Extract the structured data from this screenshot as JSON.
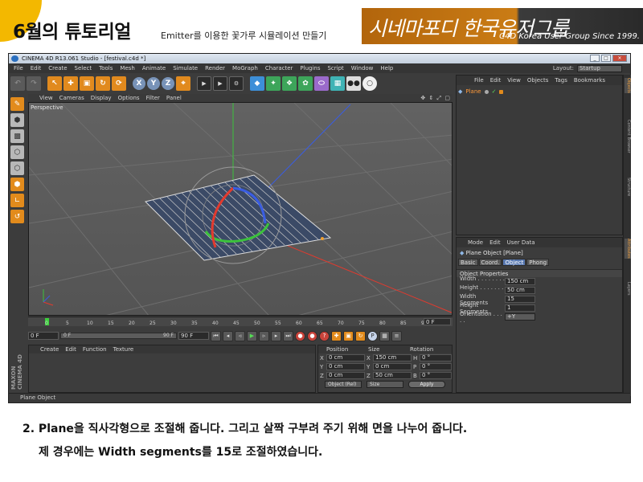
{
  "header": {
    "title": "6월의 튜토리얼",
    "subtitle": "Emitter를 이용한 꽃가루 시뮬레이션 만들기",
    "banner_script": "시네마포디 한국유저그룹",
    "banner_text": "C4D Korea User Group Since 1999."
  },
  "window": {
    "title": "CINEMA 4D R13.061 Studio - [festival.c4d *]",
    "buttons": [
      "_",
      "□",
      "×"
    ],
    "menus": [
      "File",
      "Edit",
      "Create",
      "Select",
      "Tools",
      "Mesh",
      "Animate",
      "Simulate",
      "Render",
      "MoGraph",
      "Character",
      "Plugins",
      "Script",
      "Window",
      "Help"
    ],
    "layout_label": "Layout:",
    "layout_value": "Startup"
  },
  "toolbar": {
    "axis_x": "X",
    "axis_y": "Y",
    "axis_z": "Z"
  },
  "viewport": {
    "menus": [
      "View",
      "Cameras",
      "Display",
      "Options",
      "Filter",
      "Panel"
    ],
    "label": "Perspective",
    "nav_icons": "✥ ⇕ ⤢ ▢"
  },
  "timeline": {
    "ticks": [
      "0",
      "5",
      "10",
      "15",
      "20",
      "25",
      "30",
      "35",
      "40",
      "45",
      "50",
      "55",
      "60",
      "65",
      "70",
      "75",
      "80",
      "85",
      "90"
    ],
    "current_frame": "0 F",
    "start_field": "0 F",
    "slider_start": "0 F",
    "slider_end": "90 F",
    "end_field": "90 F"
  },
  "material_manager": {
    "menus": [
      "Create",
      "Edit",
      "Function",
      "Texture"
    ],
    "brand": "MAXON CINEMA 4D"
  },
  "coordinates": {
    "headers": [
      "Position",
      "Size",
      "Rotation"
    ],
    "rows": [
      {
        "axis": "X",
        "pos": "0 cm",
        "size_axis": "X",
        "size": "150 cm",
        "rot_axis": "H",
        "rot": "0 °"
      },
      {
        "axis": "Y",
        "pos": "0 cm",
        "size_axis": "Y",
        "size": "0 cm",
        "rot_axis": "P",
        "rot": "0 °"
      },
      {
        "axis": "Z",
        "pos": "0 cm",
        "size_axis": "Z",
        "size": "50 cm",
        "rot_axis": "B",
        "rot": "0 °"
      }
    ],
    "mode_dropdown": "Object (Rel)",
    "size_dropdown": "Size",
    "apply": "Apply"
  },
  "object_manager": {
    "menus": [
      "File",
      "Edit",
      "View",
      "Objects",
      "Tags",
      "Bookmarks"
    ],
    "object_name": "Plane"
  },
  "side_tabs": [
    "Objects",
    "Content Browser",
    "Structure",
    "Attributes",
    "Layers"
  ],
  "attributes": {
    "menus": [
      "Mode",
      "Edit",
      "User Data"
    ],
    "title": "Plane Object [Plane]",
    "tabs": [
      "Basic",
      "Coord.",
      "Object",
      "Phong"
    ],
    "active_tab": "Object",
    "section": "Object Properties",
    "props": [
      {
        "label": "Width . . . . . . . . .",
        "value": "150 cm"
      },
      {
        "label": "Height . . . . . . . .",
        "value": "50 cm"
      },
      {
        "label": "Width Segments",
        "value": "15"
      },
      {
        "label": "Height Segments",
        "value": "1"
      },
      {
        "label": "Orientation . . . . .",
        "value": "+Y"
      }
    ]
  },
  "status": "Plane Object",
  "caption": {
    "line1": "2. Plane을 직사각형으로 조절해 줍니다. 그리고 살짝 구부려 주기 위해 면을 나누어 줍니다.",
    "line2": "제 경우에는 Width segments를 15로 조절하였습니다."
  },
  "colors": {
    "accent": "#f3b800",
    "c4d_orange": "#e28b1c",
    "active_tab": "#5a7ab2",
    "axis_x": "#e23a2e",
    "axis_y": "#3cc23c",
    "axis_z": "#3a5de2"
  }
}
